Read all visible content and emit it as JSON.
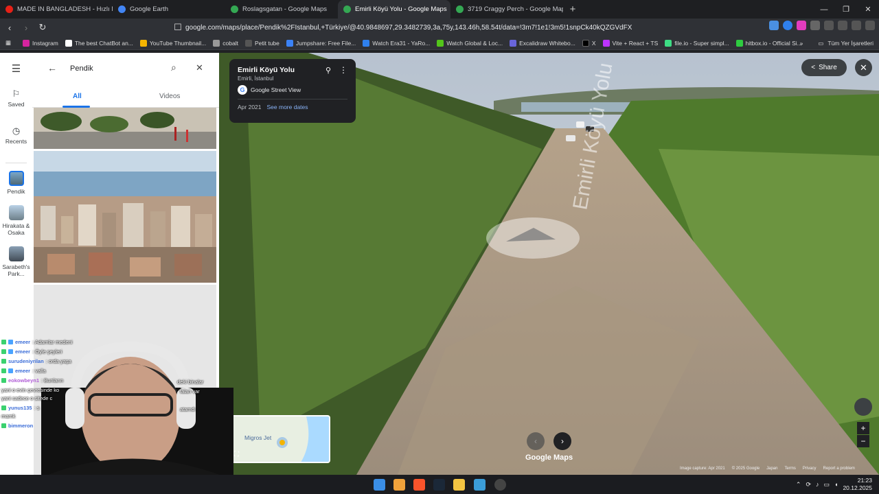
{
  "browser": {
    "tabs": [
      {
        "title": "MADE IN BANGLADESH - Hızlı Moda",
        "color": "#e62117"
      },
      {
        "title": "Google Earth",
        "color": "#4285f4"
      },
      {
        "title": "Roslagsgatan - Google Maps",
        "color": "#34a853"
      },
      {
        "title": "Emirli Köyü Yolu - Google Maps",
        "color": "#34a853",
        "active": true
      },
      {
        "title": "3719 Craggy Perch - Google Maps",
        "color": "#34a853"
      }
    ],
    "url": "google.com/maps/place/Pendik%2FIstanbul,+Türkiye/@40.9848697,29.3482739,3a,75y,143.46h,58.54t/data=!3m7!1e1!3m5!1snpCk40kQZGVdFXi7w...",
    "bookmarks": [
      {
        "label": "Instagram",
        "color": "#d6249f"
      },
      {
        "label": "The best ChatBot an...",
        "color": "#ffffff"
      },
      {
        "label": "YouTube Thumbnail...",
        "color": "#f4b400"
      },
      {
        "label": "cobalt",
        "color": "#999999"
      },
      {
        "label": "Petit tube",
        "color": "#555555"
      },
      {
        "label": "Jumpshare: Free File...",
        "color": "#3b82f6"
      },
      {
        "label": "Watch Era31 - YaRo...",
        "color": "#2f80ed"
      },
      {
        "label": "Watch Global & Loc...",
        "color": "#53c51a"
      },
      {
        "label": "Excalidraw Whitebo...",
        "color": "#6965db"
      },
      {
        "label": "X",
        "color": "#000000"
      },
      {
        "label": "Vite + React + TS",
        "color": "#bd34fe"
      },
      {
        "label": "file.io - Super simpl...",
        "color": "#3ddc84"
      },
      {
        "label": "hitbox.io - Official Si...",
        "color": "#2ecc40"
      }
    ],
    "all_bookmarks": "Tüm Yer İşaretleri"
  },
  "rail": {
    "saved": "Saved",
    "recents": "Recents",
    "items": [
      {
        "label": "Pendik"
      },
      {
        "label": "Hirakata & Osaka"
      },
      {
        "label": "Sarabeth's Park..."
      }
    ]
  },
  "panel": {
    "search_value": "Pendik",
    "tabs": [
      "All",
      "Videos"
    ]
  },
  "streetview": {
    "place_title": "Emirli Köyü Yolu",
    "place_subtitle": "Emirli, İstanbul",
    "source": "Google Street View",
    "date": "Apr 2021",
    "see_more": "See more dates",
    "share": "Share",
    "road_label": "Emirli Köyü Yolu",
    "minimap_label": "Migros Jet",
    "logo": "Google Maps",
    "footer": [
      "Image capture: Apr 2021",
      "© 2025 Google",
      "Japan",
      "Terms",
      "Privacy",
      "Report a problem"
    ]
  },
  "chat": [
    {
      "name": "emeer",
      "msg": ": Adamlar medeni"
    },
    {
      "name": "emeer",
      "msg": ": Öyle şeyleri"
    },
    {
      "name": "surudeniyrilan",
      "msg": ": orda yaşa"
    },
    {
      "name": "emeer",
      "msg": ": valla"
    },
    {
      "name": "eokowbeyn1",
      "msg": ": Bunların"
    },
    {
      "name": "",
      "msg": "yani o evin çevresinde ko"
    },
    {
      "name": "",
      "msg": "yani sadece o sitede c"
    },
    {
      "name": "yunus135",
      "msg": ": s"
    },
    {
      "name": "",
      "msg": "mamk"
    },
    {
      "name": "bimmeron",
      "msg": ""
    }
  ],
  "chat_extra": [
    "deki binalar",
    "falan var",
    "atamdı"
  ],
  "taskbar": {
    "time": "21:23",
    "date": "20.12.2025"
  }
}
